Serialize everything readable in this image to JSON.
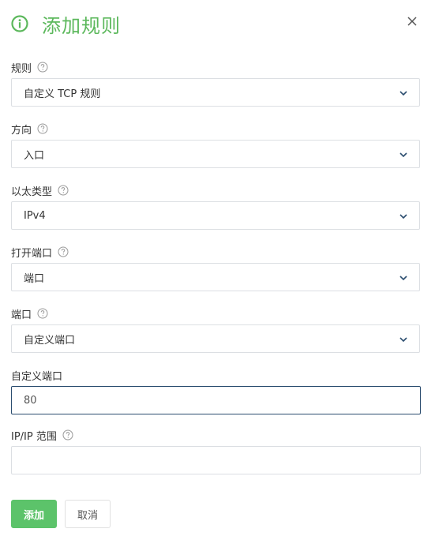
{
  "dialog": {
    "title": "添加规则",
    "icon": "info-circle-icon",
    "accent_color": "#5cb85c"
  },
  "fields": {
    "rule": {
      "label": "规则",
      "value": "自定义 TCP 规则"
    },
    "direction": {
      "label": "方向",
      "value": "入口"
    },
    "ethertype": {
      "label": "以太类型",
      "value": "IPv4"
    },
    "open_port": {
      "label": "打开端口",
      "value": "端口"
    },
    "port": {
      "label": "端口",
      "value": "自定义端口"
    },
    "custom_port": {
      "label": "自定义端口",
      "value": "80"
    },
    "ip_range": {
      "label": "IP/IP 范围",
      "value": ""
    }
  },
  "buttons": {
    "add": "添加",
    "cancel": "取消"
  }
}
